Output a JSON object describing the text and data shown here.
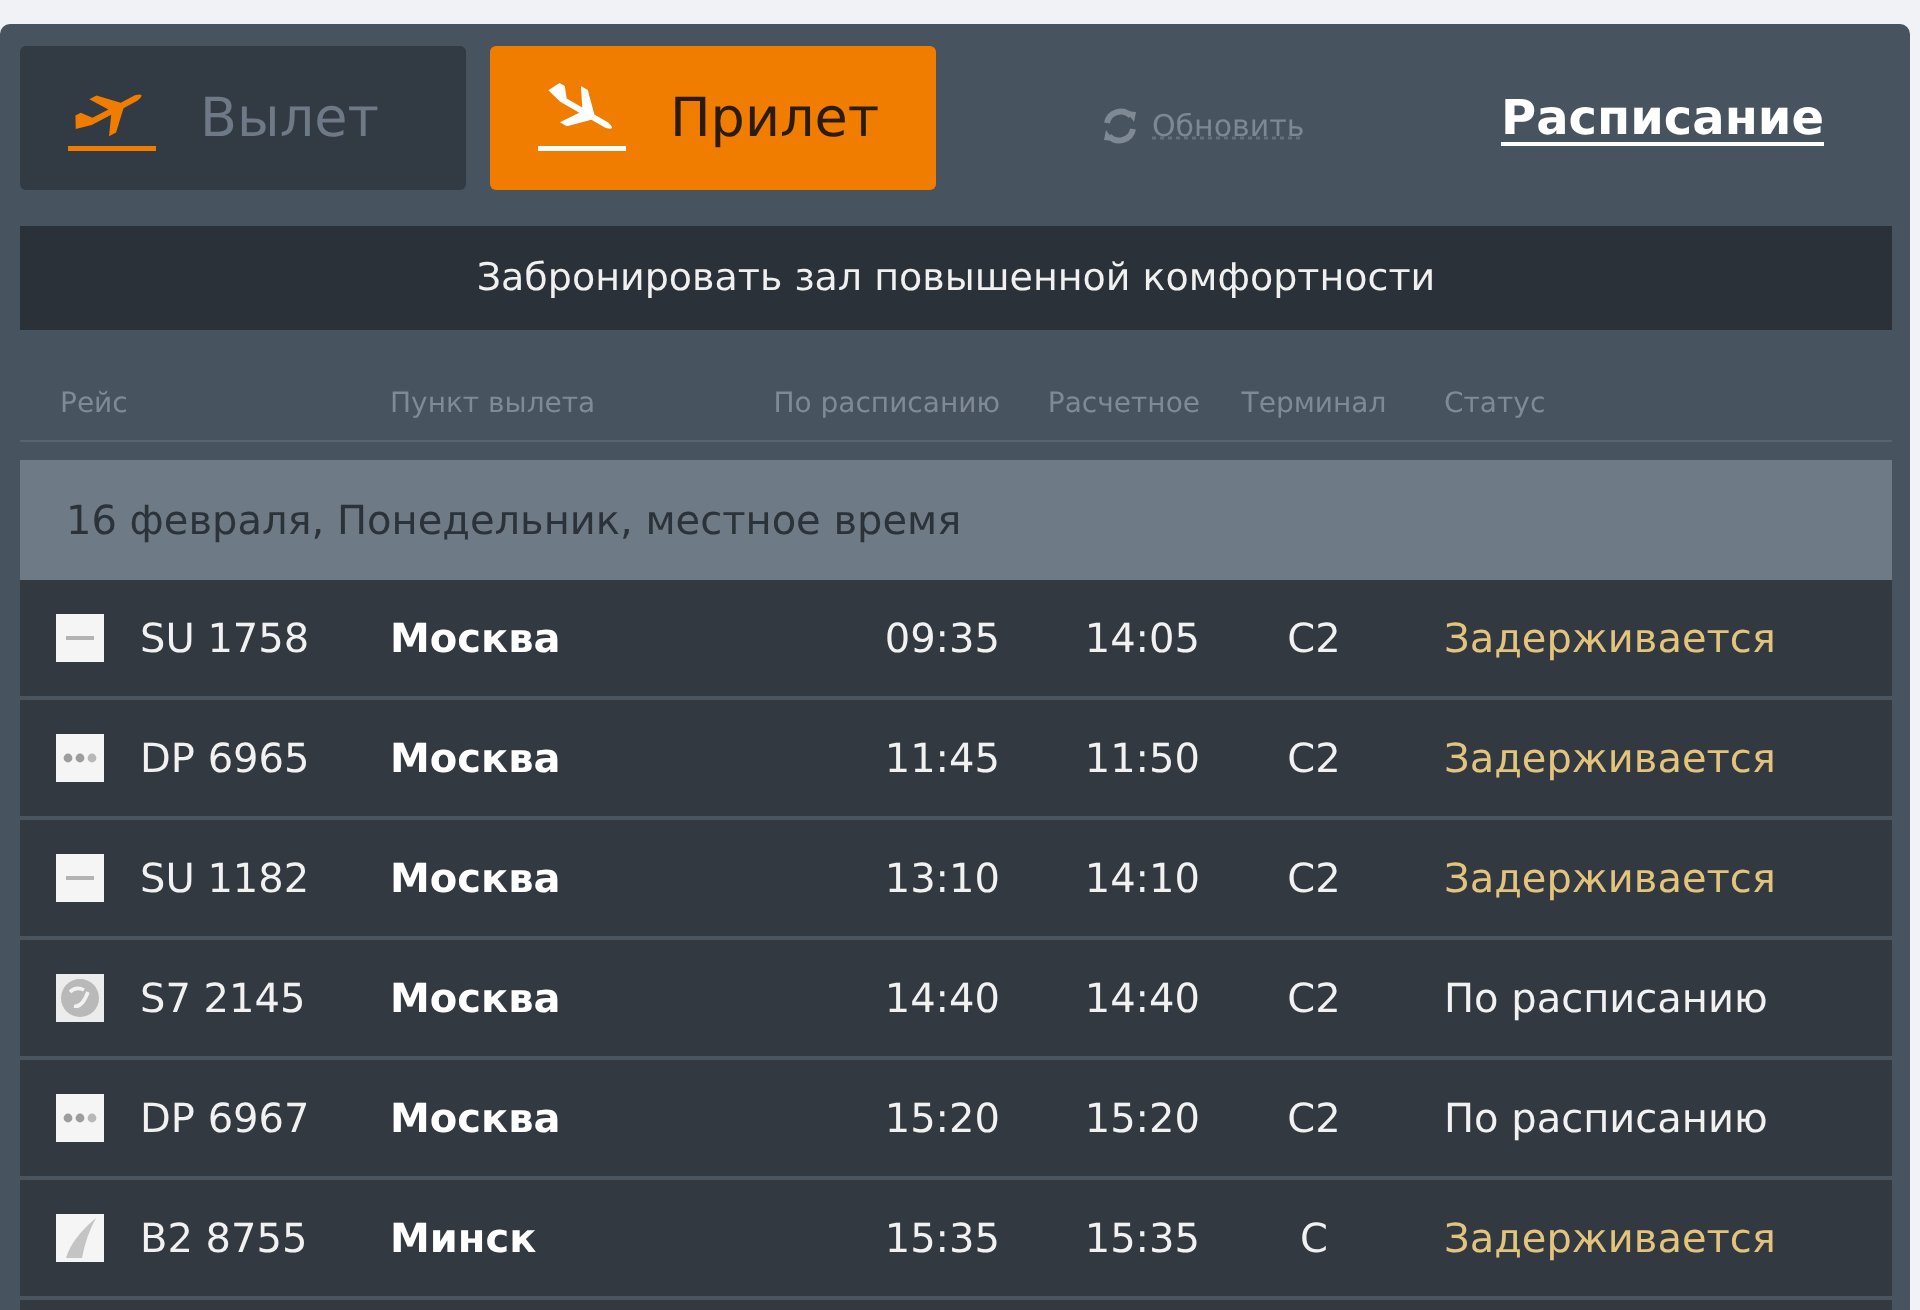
{
  "tabs": [
    {
      "kind": "departure",
      "label": "Вылет",
      "selected": false
    },
    {
      "kind": "arrival",
      "label": "Прилет",
      "selected": true
    }
  ],
  "refresh": {
    "label": "Обновить"
  },
  "schedule_link": {
    "label": "Расписание"
  },
  "booking_banner": {
    "text": "Забронировать зал повышенной комфортности"
  },
  "table": {
    "columns": [
      "Рейс",
      "Пункт вылета",
      "По расписанию",
      "Расчетное",
      "Терминал",
      "Статус"
    ],
    "date_header": "16 февраля, Понедельник, местное время",
    "rows": [
      {
        "logo": {
          "kind": "dash"
        },
        "flight": "SU 1758",
        "city": "Москва",
        "scheduled": "09:35",
        "estimated": "14:05",
        "terminal": "C2",
        "status": "Задерживается",
        "delayed": true
      },
      {
        "logo": {
          "kind": "dots"
        },
        "flight": "DP 6965",
        "city": "Москва",
        "scheduled": "11:45",
        "estimated": "11:50",
        "terminal": "C2",
        "status": "Задерживается",
        "delayed": true
      },
      {
        "logo": {
          "kind": "dash"
        },
        "flight": "SU 1182",
        "city": "Москва",
        "scheduled": "13:10",
        "estimated": "14:10",
        "terminal": "C2",
        "status": "Задерживается",
        "delayed": true
      },
      {
        "logo": {
          "kind": "circle"
        },
        "flight": "S7 2145",
        "city": "Москва",
        "scheduled": "14:40",
        "estimated": "14:40",
        "terminal": "C2",
        "status": "По расписанию",
        "delayed": false
      },
      {
        "logo": {
          "kind": "dots"
        },
        "flight": "DP 6967",
        "city": "Москва",
        "scheduled": "15:20",
        "estimated": "15:20",
        "terminal": "C2",
        "status": "По расписанию",
        "delayed": false
      },
      {
        "logo": {
          "kind": "swoosh"
        },
        "flight": "B2 8755",
        "city": "Минск",
        "scheduled": "15:35",
        "estimated": "15:35",
        "terminal": "C",
        "status": "Задерживается",
        "delayed": true
      }
    ]
  }
}
